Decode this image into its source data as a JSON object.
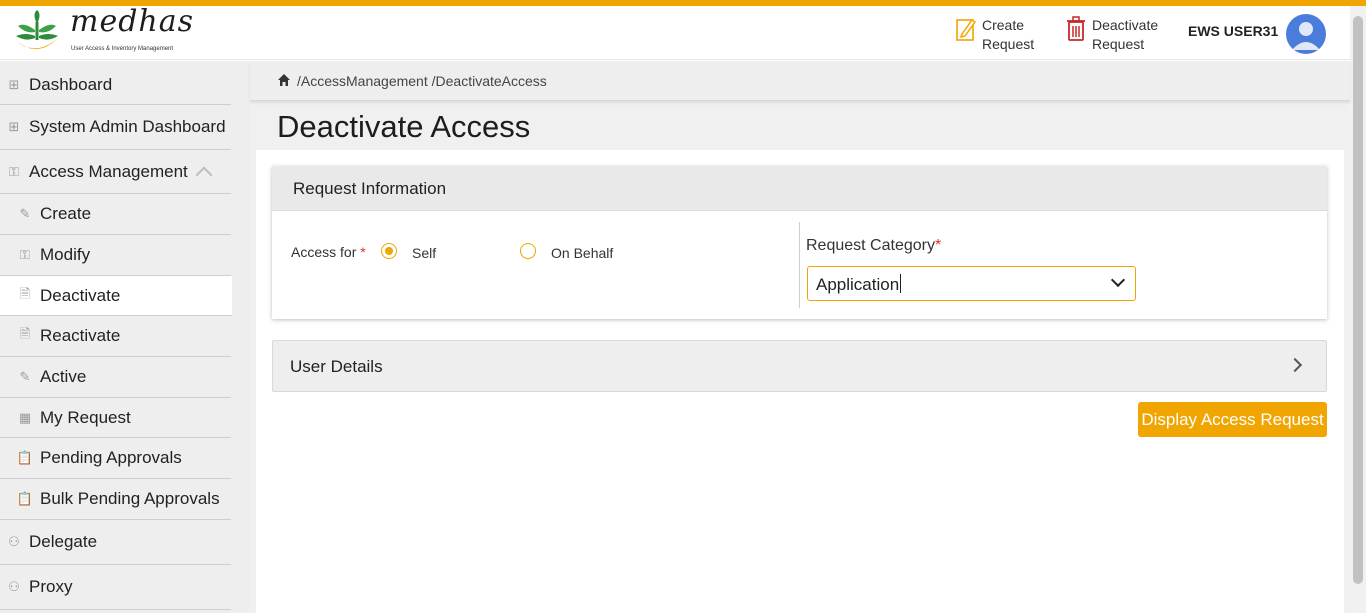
{
  "brand": {
    "name": "medhas",
    "subtitle": "User Access & Inventory Management",
    "accent_color": "#f0a500"
  },
  "header": {
    "create_request_label": "Create Request",
    "deactivate_request_label": "Deactivate Request",
    "user_name": "EWS USER31"
  },
  "sidebar": {
    "items": [
      {
        "label": "Dashboard",
        "icon": "grid-icon"
      },
      {
        "label": "System Admin Dashboard",
        "icon": "grid-icon"
      },
      {
        "label": "Access Management",
        "icon": "key-icon",
        "expanded": true
      },
      {
        "label": "Create",
        "icon": "edit-icon"
      },
      {
        "label": "Modify",
        "icon": "key-icon"
      },
      {
        "label": "Deactivate",
        "icon": "document-icon",
        "active": true
      },
      {
        "label": "Reactivate",
        "icon": "document-icon"
      },
      {
        "label": "Active",
        "icon": "edit-icon"
      },
      {
        "label": "My Request",
        "icon": "table-icon"
      },
      {
        "label": "Pending Approvals",
        "icon": "clipboard-icon"
      },
      {
        "label": "Bulk Pending Approvals",
        "icon": "clipboard-icon"
      },
      {
        "label": "Delegate",
        "icon": "people-icon"
      },
      {
        "label": "Proxy",
        "icon": "people-icon"
      }
    ]
  },
  "breadcrumb": {
    "path": "/AccessManagement /DeactivateAccess"
  },
  "page": {
    "title": "Deactivate Access"
  },
  "request_info": {
    "title": "Request Information",
    "access_for_label": "Access for",
    "required_mark": "*",
    "options": [
      {
        "label": "Self",
        "selected": true
      },
      {
        "label": "On Behalf",
        "selected": false
      }
    ],
    "category_label": "Request Category",
    "category_value": "Application"
  },
  "user_details": {
    "title": "User Details"
  },
  "actions": {
    "display_label": "Display Access Request"
  }
}
